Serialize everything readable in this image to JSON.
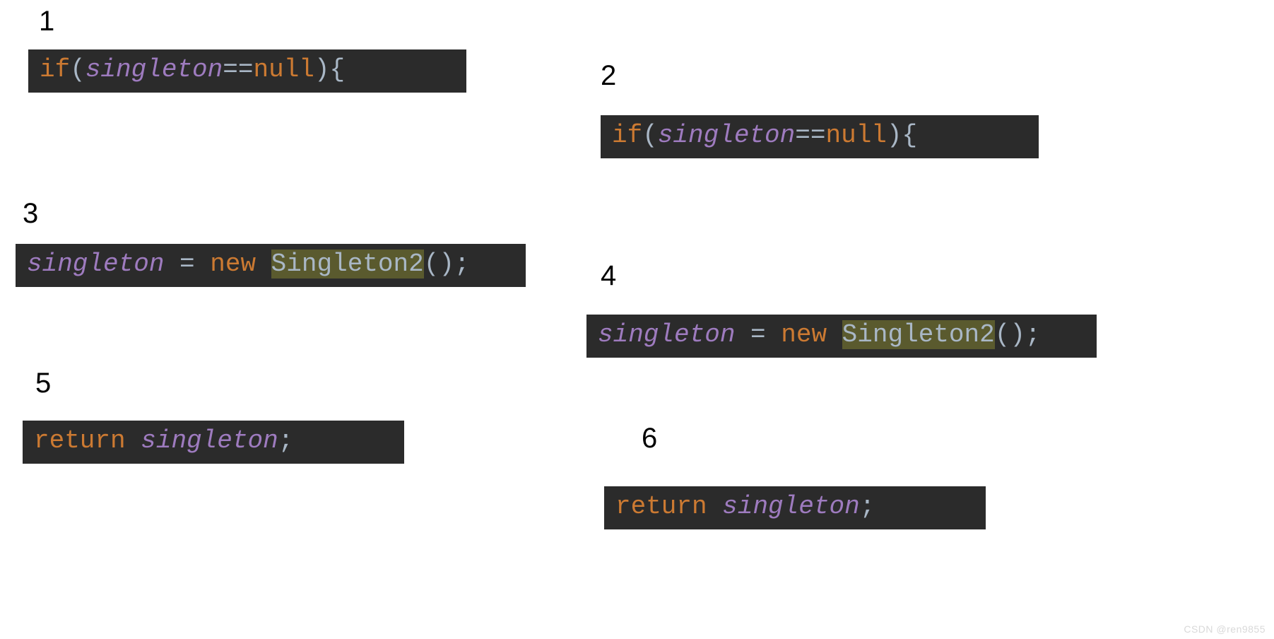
{
  "watermark": "CSDN @ren9855",
  "steps": {
    "s1": {
      "label": "1"
    },
    "s2": {
      "label": "2"
    },
    "s3": {
      "label": "3"
    },
    "s4": {
      "label": "4"
    },
    "s5": {
      "label": "5"
    },
    "s6": {
      "label": "6"
    }
  },
  "code": {
    "kw_if": "if",
    "kw_new": "new",
    "kw_return": "return",
    "var_singleton": "singleton",
    "op_eqeq": "==",
    "op_assign": " = ",
    "lit_null": "null",
    "class_name": "Singleton2",
    "lparen": "(",
    "rparen": ")",
    "lbrace": "{",
    "unit_call": "()",
    "semi": ";"
  }
}
